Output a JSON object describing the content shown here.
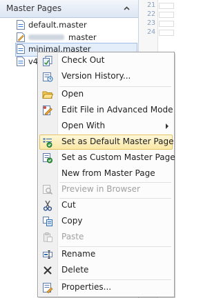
{
  "panel": {
    "title": "Master Pages",
    "items": [
      {
        "label": "default.master",
        "selected": false,
        "blurred": false
      },
      {
        "label": "master",
        "selected": false,
        "blurred": true
      },
      {
        "label": "minimal.master",
        "selected": true,
        "blurred": false
      },
      {
        "label": "v4",
        "selected": false,
        "blurred": false
      }
    ]
  },
  "editor": {
    "line_numbers": [
      "21",
      "22",
      "23",
      "24"
    ]
  },
  "context_menu": {
    "items": [
      {
        "label": "Check Out",
        "icon": "check-out-icon",
        "enabled": true
      },
      {
        "label": "Version History...",
        "icon": "version-history-icon",
        "enabled": true
      },
      {
        "label": "Open",
        "icon": "open-folder-icon",
        "enabled": true
      },
      {
        "label": "Edit File in Advanced Mode",
        "icon": "edit-advanced-icon",
        "enabled": true
      },
      {
        "label": "Open With",
        "icon": "",
        "enabled": true,
        "submenu": true
      },
      {
        "label": "Set as Default Master Page",
        "icon": "set-default-master-icon",
        "enabled": true,
        "highlighted": true
      },
      {
        "label": "Set as Custom Master Page",
        "icon": "set-custom-master-icon",
        "enabled": true
      },
      {
        "label": "New from Master Page",
        "icon": "",
        "enabled": true
      },
      {
        "label": "Preview in Browser",
        "icon": "preview-browser-icon",
        "enabled": false
      },
      {
        "label": "Cut",
        "icon": "cut-icon",
        "enabled": true
      },
      {
        "label": "Copy",
        "icon": "copy-icon",
        "enabled": true
      },
      {
        "label": "Paste",
        "icon": "paste-icon",
        "enabled": false
      },
      {
        "label": "Rename",
        "icon": "rename-icon",
        "enabled": true
      },
      {
        "label": "Delete",
        "icon": "delete-icon",
        "enabled": true
      },
      {
        "label": "Properties...",
        "icon": "properties-icon",
        "enabled": true
      }
    ]
  },
  "colors": {
    "panel_header": "#dce6f4",
    "selection": "#e4eefb",
    "menu_highlight": "#fbe9a6",
    "disabled_text": "#a0a0a0"
  }
}
